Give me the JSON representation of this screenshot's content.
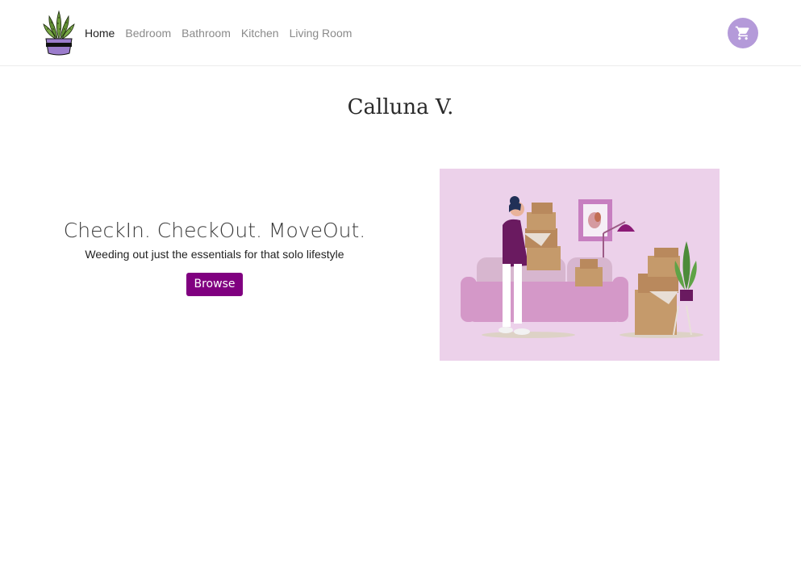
{
  "nav": {
    "links": [
      {
        "label": "Home",
        "active": true
      },
      {
        "label": "Bedroom",
        "active": false
      },
      {
        "label": "Bathroom",
        "active": false
      },
      {
        "label": "Kitchen",
        "active": false
      },
      {
        "label": "Living Room",
        "active": false
      }
    ],
    "logo_icon": "potted-plant-icon",
    "cart_icon": "shopping-cart-icon"
  },
  "brand": {
    "title": "Calluna V."
  },
  "hero": {
    "headline": "CheckIn. CheckOut. MoveOut.",
    "subtitle": "Weeding out just the essentials for that solo lifestyle",
    "browse_label": "Browse"
  },
  "colors": {
    "accent": "#800080",
    "cart_bg": "#b49ad9",
    "illustration_bg": "#ecd1ea"
  }
}
